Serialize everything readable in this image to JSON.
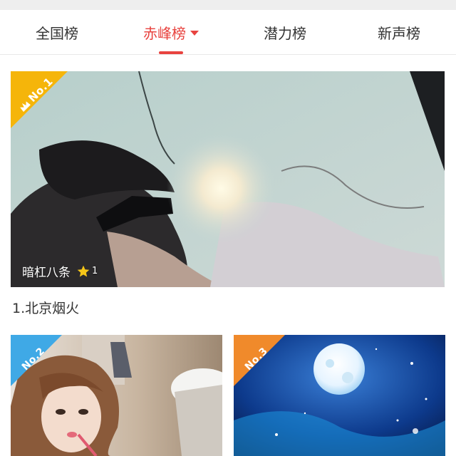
{
  "tabs": [
    {
      "label": "全国榜",
      "active": false
    },
    {
      "label": "赤峰榜",
      "active": true
    },
    {
      "label": "潜力榜",
      "active": false
    },
    {
      "label": "新声榜",
      "active": false
    }
  ],
  "colors": {
    "accent": "#e8433f",
    "badge_gold": "#f5b50a",
    "badge_blue": "#3fa9e6",
    "badge_orange": "#f08a2b"
  },
  "cards": [
    {
      "badge": "No.1",
      "singer": "暗杠八条",
      "star_count": "1",
      "rank_title": "1.北京烟火",
      "badge_icon": "crown-icon"
    },
    {
      "badge": "No.2"
    },
    {
      "badge": "No.3"
    }
  ]
}
